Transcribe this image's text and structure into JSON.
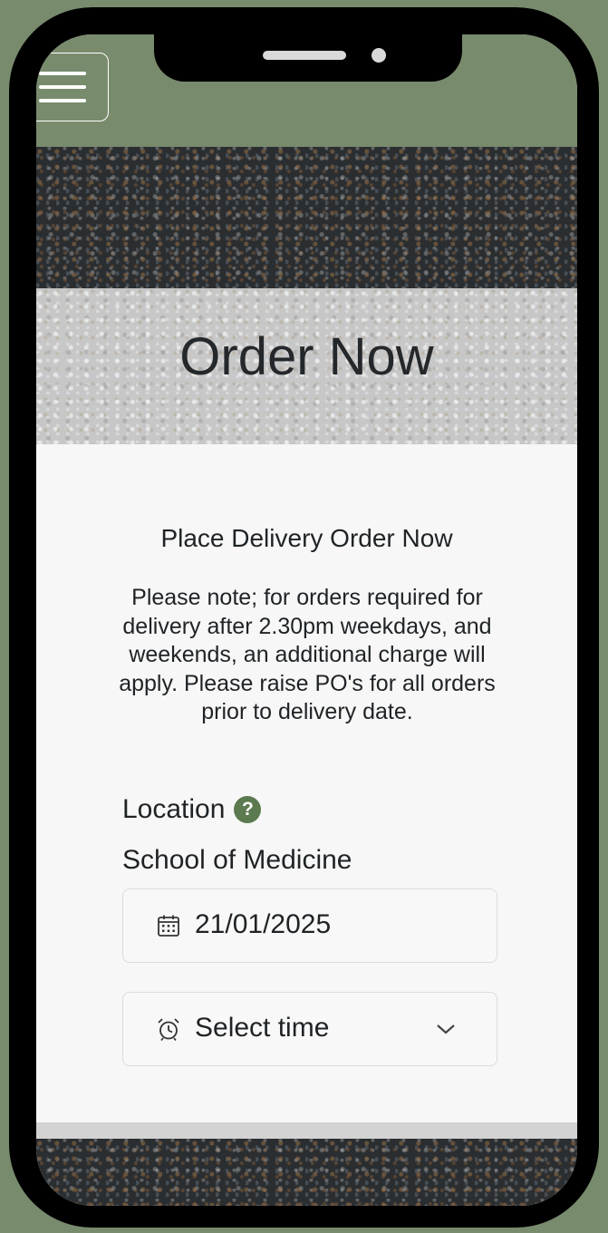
{
  "page": {
    "title": "Order Now"
  },
  "form": {
    "subtitle": "Place Delivery Order Now",
    "note": "Please note; for orders required for delivery after 2.30pm weekdays, and weekends, an additional charge will apply. Please raise PO's for all orders prior to delivery date.",
    "location_label": "Location",
    "help_glyph": "?",
    "location_value": "School of Medicine",
    "date_value": "21/01/2025",
    "time_placeholder": "Select time"
  },
  "icons": {
    "menu": "hamburger-icon",
    "help": "question-circle-icon",
    "date": "calendar-icon",
    "time": "alarm-clock-icon",
    "dropdown": "chevron-down-icon"
  },
  "colors": {
    "header": "#788b6d",
    "help_icon": "#5b7a4f",
    "text": "#1f2326"
  }
}
